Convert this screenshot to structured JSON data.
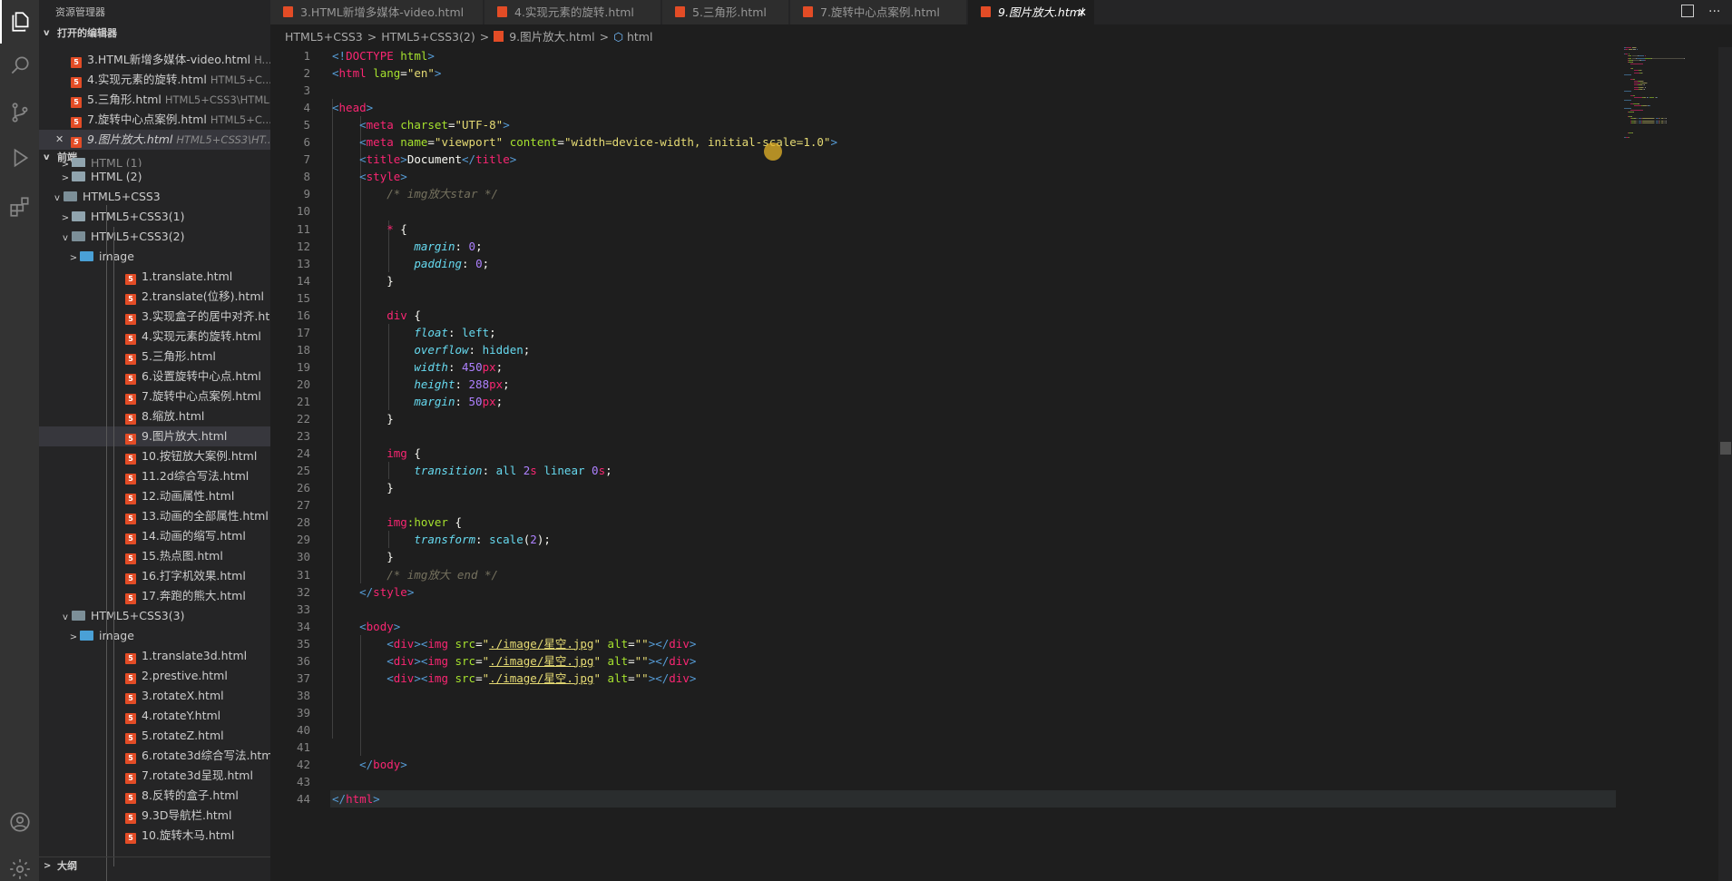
{
  "sidebar": {
    "title": "资源管理器",
    "open_editors_label": "打开的编辑器",
    "open_editors": [
      {
        "name": "3.HTML新增多媒体-video.html",
        "path": "H..."
      },
      {
        "name": "4.实现元素的旋转.html",
        "path": "HTML5+C..."
      },
      {
        "name": "5.三角形.html",
        "path": "HTML5+CSS3\\HTML..."
      },
      {
        "name": "7.旋转中心点案例.html",
        "path": "HTML5+C..."
      },
      {
        "name": "9.图片放大.html",
        "path": "HTML5+CSS3\\HT..."
      }
    ],
    "folder_label": "前端",
    "tree": [
      {
        "label": "HTML (1)",
        "type": "folder"
      },
      {
        "label": "HTML (2)",
        "type": "folder"
      },
      {
        "label": "HTML5+CSS3",
        "type": "folder-open"
      },
      {
        "label": "HTML5+CSS3(1)",
        "type": "folder"
      },
      {
        "label": "HTML5+CSS3(2)",
        "type": "folder-open"
      },
      {
        "label": "image",
        "type": "image-folder"
      },
      {
        "label": "1.translate.html",
        "type": "file"
      },
      {
        "label": "2.translate(位移).html",
        "type": "file"
      },
      {
        "label": "3.实现盒子的居中对齐.html",
        "type": "file"
      },
      {
        "label": "4.实现元素的旋转.html",
        "type": "file"
      },
      {
        "label": "5.三角形.html",
        "type": "file"
      },
      {
        "label": "6.设置旋转中心点.html",
        "type": "file"
      },
      {
        "label": "7.旋转中心点案例.html",
        "type": "file"
      },
      {
        "label": "8.缩放.html",
        "type": "file"
      },
      {
        "label": "9.图片放大.html",
        "type": "file"
      },
      {
        "label": "10.按钮放大案例.html",
        "type": "file"
      },
      {
        "label": "11.2d综合写法.html",
        "type": "file"
      },
      {
        "label": "12.动画属性.html",
        "type": "file"
      },
      {
        "label": "13.动画的全部属性.html",
        "type": "file"
      },
      {
        "label": "14.动画的缩写.html",
        "type": "file"
      },
      {
        "label": "15.热点图.html",
        "type": "file"
      },
      {
        "label": "16.打字机效果.html",
        "type": "file"
      },
      {
        "label": "17.奔跑的熊大.html",
        "type": "file"
      },
      {
        "label": "HTML5+CSS3(3)",
        "type": "folder-open"
      },
      {
        "label": "image",
        "type": "image-folder"
      },
      {
        "label": "1.translate3d.html",
        "type": "file"
      },
      {
        "label": "2.prestive.html",
        "type": "file"
      },
      {
        "label": "3.rotateX.html",
        "type": "file"
      },
      {
        "label": "4.rotateY.html",
        "type": "file"
      },
      {
        "label": "5.rotateZ.html",
        "type": "file"
      },
      {
        "label": "6.rotate3d综合写法.html",
        "type": "file"
      },
      {
        "label": "7.rotate3d呈现.html",
        "type": "file"
      },
      {
        "label": "8.反转的盒子.html",
        "type": "file"
      },
      {
        "label": "9.3D导航栏.html",
        "type": "file"
      },
      {
        "label": "10.旋转木马.html",
        "type": "file"
      }
    ],
    "outline_label": "大纲"
  },
  "tabs": [
    {
      "label": "3.HTML新增多媒体-video.html"
    },
    {
      "label": "4.实现元素的旋转.html"
    },
    {
      "label": "5.三角形.html"
    },
    {
      "label": "7.旋转中心点案例.html"
    },
    {
      "label": "9.图片放大.html",
      "active": true
    }
  ],
  "breadcrumb": {
    "parts": [
      "HTML5+CSS3",
      "HTML5+CSS3(2)",
      "9.图片放大.html",
      "html"
    ]
  },
  "editor": {
    "lines": [
      [
        [
          "t",
          "<!"
        ],
        [
          "tp",
          "DOCTYPE"
        ],
        [
          "w",
          " "
        ],
        [
          "a",
          "html"
        ],
        [
          "t",
          ">"
        ]
      ],
      [
        [
          "t",
          "<"
        ],
        [
          "tp",
          "html"
        ],
        [
          "w",
          " "
        ],
        [
          "a",
          "lang"
        ],
        [
          "w",
          "="
        ],
        [
          "s",
          "\"en\""
        ],
        [
          "t",
          ">"
        ]
      ],
      [],
      [
        [
          "t",
          "<"
        ],
        [
          "tp",
          "head"
        ],
        [
          "t",
          ">"
        ]
      ],
      [
        [
          "w",
          "    "
        ],
        [
          "t",
          "<"
        ],
        [
          "tp",
          "meta"
        ],
        [
          "w",
          " "
        ],
        [
          "a",
          "charset"
        ],
        [
          "w",
          "="
        ],
        [
          "s",
          "\"UTF-8\""
        ],
        [
          "t",
          ">"
        ]
      ],
      [
        [
          "w",
          "    "
        ],
        [
          "t",
          "<"
        ],
        [
          "tp",
          "meta"
        ],
        [
          "w",
          " "
        ],
        [
          "a",
          "name"
        ],
        [
          "w",
          "="
        ],
        [
          "s",
          "\"viewport\""
        ],
        [
          "w",
          " "
        ],
        [
          "a",
          "content"
        ],
        [
          "w",
          "="
        ],
        [
          "s",
          "\"width=device-width, initial-scale=1.0\""
        ],
        [
          "t",
          ">"
        ]
      ],
      [
        [
          "w",
          "    "
        ],
        [
          "t",
          "<"
        ],
        [
          "tp",
          "title"
        ],
        [
          "t",
          ">"
        ],
        [
          "w",
          "Document"
        ],
        [
          "t",
          "</"
        ],
        [
          "tp",
          "title"
        ],
        [
          "t",
          ">"
        ]
      ],
      [
        [
          "w",
          "    "
        ],
        [
          "t",
          "<"
        ],
        [
          "tp",
          "style"
        ],
        [
          "t",
          ">"
        ]
      ],
      [
        [
          "w",
          "        "
        ],
        [
          "c",
          "/* img放大star */"
        ]
      ],
      [],
      [
        [
          "w",
          "        "
        ],
        [
          "tp",
          "*"
        ],
        [
          "w",
          " {"
        ]
      ],
      [
        [
          "w",
          "            "
        ],
        [
          "p",
          "margin"
        ],
        [
          "w",
          ": "
        ],
        [
          "n",
          "0"
        ],
        [
          "w",
          ";"
        ]
      ],
      [
        [
          "w",
          "            "
        ],
        [
          "p",
          "padding"
        ],
        [
          "w",
          ": "
        ],
        [
          "n",
          "0"
        ],
        [
          "w",
          ";"
        ]
      ],
      [
        [
          "w",
          "        }"
        ]
      ],
      [],
      [
        [
          "w",
          "        "
        ],
        [
          "tp",
          "div"
        ],
        [
          "w",
          " {"
        ]
      ],
      [
        [
          "w",
          "            "
        ],
        [
          "p",
          "float"
        ],
        [
          "w",
          ": "
        ],
        [
          "k",
          "left"
        ],
        [
          "w",
          ";"
        ]
      ],
      [
        [
          "w",
          "            "
        ],
        [
          "p",
          "overflow"
        ],
        [
          "w",
          ": "
        ],
        [
          "k",
          "hidden"
        ],
        [
          "w",
          ";"
        ]
      ],
      [
        [
          "w",
          "            "
        ],
        [
          "p",
          "width"
        ],
        [
          "w",
          ": "
        ],
        [
          "n",
          "450"
        ],
        [
          "tp",
          "px"
        ],
        [
          "w",
          ";"
        ]
      ],
      [
        [
          "w",
          "            "
        ],
        [
          "p",
          "height"
        ],
        [
          "w",
          ": "
        ],
        [
          "n",
          "288"
        ],
        [
          "tp",
          "px"
        ],
        [
          "w",
          ";"
        ]
      ],
      [
        [
          "w",
          "            "
        ],
        [
          "p",
          "margin"
        ],
        [
          "w",
          ": "
        ],
        [
          "n",
          "50"
        ],
        [
          "tp",
          "px"
        ],
        [
          "w",
          ";"
        ]
      ],
      [
        [
          "w",
          "        }"
        ]
      ],
      [],
      [
        [
          "w",
          "        "
        ],
        [
          "tp",
          "img"
        ],
        [
          "w",
          " {"
        ]
      ],
      [
        [
          "w",
          "            "
        ],
        [
          "p",
          "transition"
        ],
        [
          "w",
          ": "
        ],
        [
          "k",
          "all"
        ],
        [
          "w",
          " "
        ],
        [
          "n",
          "2"
        ],
        [
          "tp",
          "s"
        ],
        [
          "w",
          " "
        ],
        [
          "k",
          "linear"
        ],
        [
          "w",
          " "
        ],
        [
          "n",
          "0"
        ],
        [
          "tp",
          "s"
        ],
        [
          "w",
          ";"
        ]
      ],
      [
        [
          "w",
          "        }"
        ]
      ],
      [],
      [
        [
          "w",
          "        "
        ],
        [
          "tp",
          "img"
        ],
        [
          "a",
          ":hover"
        ],
        [
          "w",
          " {"
        ]
      ],
      [
        [
          "w",
          "            "
        ],
        [
          "p",
          "transform"
        ],
        [
          "w",
          ": "
        ],
        [
          "k",
          "scale"
        ],
        [
          "w",
          "("
        ],
        [
          "n",
          "2"
        ],
        [
          "w",
          ");"
        ]
      ],
      [
        [
          "w",
          "        }"
        ]
      ],
      [
        [
          "w",
          "        "
        ],
        [
          "c",
          "/* img放大 end */"
        ]
      ],
      [
        [
          "w",
          "    "
        ],
        [
          "t",
          "</"
        ],
        [
          "tp",
          "style"
        ],
        [
          "t",
          ">"
        ]
      ],
      [],
      [
        [
          "w",
          "    "
        ],
        [
          "t",
          "<"
        ],
        [
          "tp",
          "body"
        ],
        [
          "t",
          ">"
        ]
      ],
      [
        [
          "w",
          "        "
        ],
        [
          "t",
          "<"
        ],
        [
          "tp",
          "div"
        ],
        [
          "t",
          "><"
        ],
        [
          "tp",
          "img"
        ],
        [
          "w",
          " "
        ],
        [
          "a",
          "src"
        ],
        [
          "w",
          "="
        ],
        [
          "s",
          "\""
        ],
        [
          "u",
          "./image/星空.jpg"
        ],
        [
          "s",
          "\""
        ],
        [
          "w",
          " "
        ],
        [
          "a",
          "alt"
        ],
        [
          "w",
          "="
        ],
        [
          "s",
          "\"\""
        ],
        [
          "t",
          "></"
        ],
        [
          "tp",
          "div"
        ],
        [
          "t",
          ">"
        ]
      ],
      [
        [
          "w",
          "        "
        ],
        [
          "t",
          "<"
        ],
        [
          "tp",
          "div"
        ],
        [
          "t",
          "><"
        ],
        [
          "tp",
          "img"
        ],
        [
          "w",
          " "
        ],
        [
          "a",
          "src"
        ],
        [
          "w",
          "="
        ],
        [
          "s",
          "\""
        ],
        [
          "u",
          "./image/星空.jpg"
        ],
        [
          "s",
          "\""
        ],
        [
          "w",
          " "
        ],
        [
          "a",
          "alt"
        ],
        [
          "w",
          "="
        ],
        [
          "s",
          "\"\""
        ],
        [
          "t",
          "></"
        ],
        [
          "tp",
          "div"
        ],
        [
          "t",
          ">"
        ]
      ],
      [
        [
          "w",
          "        "
        ],
        [
          "t",
          "<"
        ],
        [
          "tp",
          "div"
        ],
        [
          "t",
          "><"
        ],
        [
          "tp",
          "img"
        ],
        [
          "w",
          " "
        ],
        [
          "a",
          "src"
        ],
        [
          "w",
          "="
        ],
        [
          "s",
          "\""
        ],
        [
          "u",
          "./image/星空.jpg"
        ],
        [
          "s",
          "\""
        ],
        [
          "w",
          " "
        ],
        [
          "a",
          "alt"
        ],
        [
          "w",
          "="
        ],
        [
          "s",
          "\"\""
        ],
        [
          "t",
          "></"
        ],
        [
          "tp",
          "div"
        ],
        [
          "t",
          ">"
        ]
      ],
      [],
      [],
      [],
      [],
      [
        [
          "w",
          "    "
        ],
        [
          "t",
          "</"
        ],
        [
          "tp",
          "body"
        ],
        [
          "t",
          ">"
        ]
      ],
      [],
      [
        [
          "t",
          "</"
        ],
        [
          "tp",
          "html"
        ],
        [
          "t",
          ">"
        ]
      ]
    ],
    "current_line": 44
  }
}
